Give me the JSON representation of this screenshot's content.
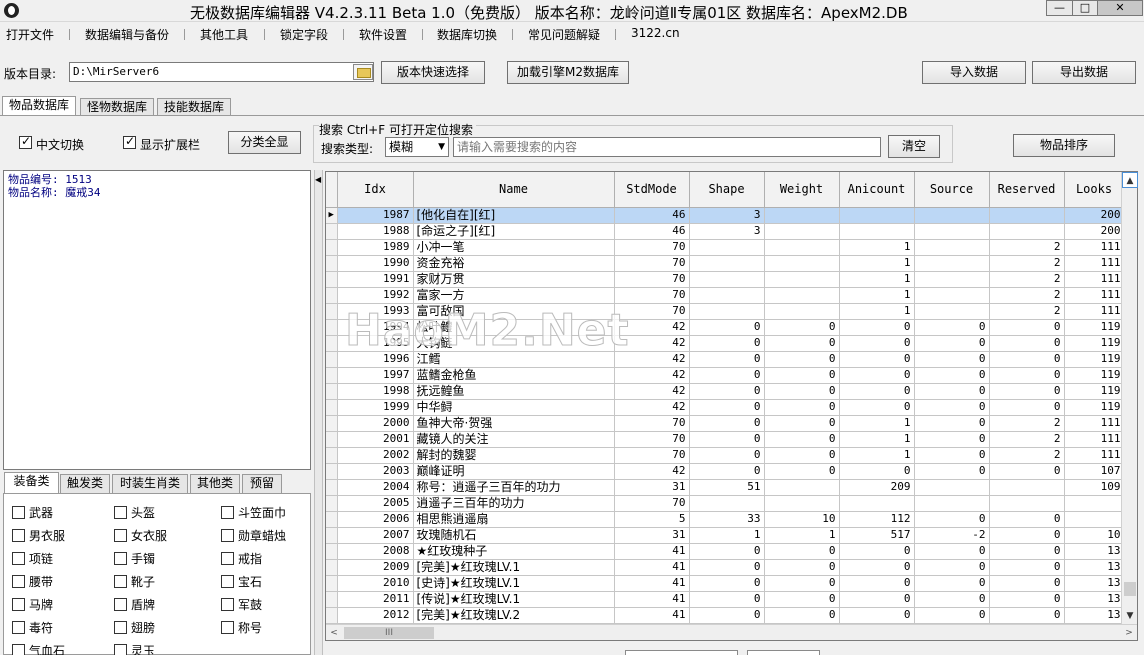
{
  "window": {
    "title": "无极数据库编辑器 V4.2.3.11    Beta 1.0（免费版）    版本名称：龙岭问道Ⅱ专属01区    数据库名：ApexM2.DB",
    "min": "—",
    "max": "□",
    "close": "✕"
  },
  "menu": [
    "打开文件",
    "数据编辑与备份",
    "其他工具",
    "锁定字段",
    "软件设置",
    "数据库切换",
    "常见问题解疑",
    "3122.cn"
  ],
  "toolbar": {
    "dir_label": "版本目录:",
    "dir_value": "D:\\MirServer6",
    "quick_select": "版本快速选择",
    "load_db": "加载引擎M2数据库",
    "import": "导入数据",
    "export": "导出数据"
  },
  "tabs": [
    "物品数据库",
    "怪物数据库",
    "技能数据库"
  ],
  "options": {
    "chinese_switch": "中文切换",
    "show_ext": "显示扩展栏",
    "show_all": "分类全显"
  },
  "search": {
    "title": "搜索  Ctrl+F 可打开定位搜索",
    "type_label": "搜索类型:",
    "type_value": "模糊",
    "placeholder": "请输入需要搜索的内容",
    "clear": "清空",
    "sort": "物品排序"
  },
  "info": {
    "line1": "物品编号: 1513",
    "line2": "物品名称: 魔戒34"
  },
  "category_tabs": [
    "装备类",
    "触发类",
    "时装生肖类",
    "其他类",
    "预留"
  ],
  "categories": [
    "武器",
    "头盔",
    "斗笠面巾",
    "男衣服",
    "女衣服",
    "勋章蜡烛",
    "项链",
    "手镯",
    "戒指",
    "腰带",
    "靴子",
    "宝石",
    "马牌",
    "盾牌",
    "军鼓",
    "毒符",
    "翅膀",
    "称号",
    "气血石",
    "灵玉"
  ],
  "grid": {
    "columns": [
      "Idx",
      "Name",
      "StdMode",
      "Shape",
      "Weight",
      "Anicount",
      "Source",
      "Reserved",
      "Looks"
    ],
    "rows": [
      [
        "1987",
        "[他化自在][红]",
        "46",
        "3",
        "",
        "",
        "",
        "",
        "200"
      ],
      [
        "1988",
        "[命运之子][红]",
        "46",
        "3",
        "",
        "",
        "",
        "",
        "200"
      ],
      [
        "1989",
        "小冲一笔",
        "70",
        "",
        "",
        "1",
        "",
        "2",
        "111"
      ],
      [
        "1990",
        "资金充裕",
        "70",
        "",
        "",
        "1",
        "",
        "2",
        "111"
      ],
      [
        "1991",
        "家财万贯",
        "70",
        "",
        "",
        "1",
        "",
        "2",
        "111"
      ],
      [
        "1992",
        "富家一方",
        "70",
        "",
        "",
        "1",
        "",
        "2",
        "111"
      ],
      [
        "1993",
        "富可敌国",
        "70",
        "",
        "",
        "1",
        "",
        "2",
        "111"
      ],
      [
        "1994",
        "松叶鳢",
        "42",
        "0",
        "0",
        "0",
        "0",
        "0",
        "119"
      ],
      [
        "1995",
        "大钩鲢",
        "42",
        "0",
        "0",
        "0",
        "0",
        "0",
        "119"
      ],
      [
        "1996",
        "江鳕",
        "42",
        "0",
        "0",
        "0",
        "0",
        "0",
        "119"
      ],
      [
        "1997",
        "蓝鳍金枪鱼",
        "42",
        "0",
        "0",
        "0",
        "0",
        "0",
        "119"
      ],
      [
        "1998",
        "抚远鳇鱼",
        "42",
        "0",
        "0",
        "0",
        "0",
        "0",
        "119"
      ],
      [
        "1999",
        "中华鲟",
        "42",
        "0",
        "0",
        "0",
        "0",
        "0",
        "119"
      ],
      [
        "2000",
        "鱼神大帝·贺强",
        "70",
        "0",
        "0",
        "1",
        "0",
        "2",
        "111"
      ],
      [
        "2001",
        "藏镜人的关注",
        "70",
        "0",
        "0",
        "1",
        "0",
        "2",
        "111"
      ],
      [
        "2002",
        "解封的魏婴",
        "70",
        "0",
        "0",
        "1",
        "0",
        "2",
        "111"
      ],
      [
        "2003",
        "巅峰证明",
        "42",
        "0",
        "0",
        "0",
        "0",
        "0",
        "107"
      ],
      [
        "2004",
        "称号：逍遥子三百年的功力",
        "31",
        "51",
        "",
        "209",
        "",
        "",
        "109"
      ],
      [
        "2005",
        "逍遥子三百年的功力",
        "70",
        "",
        "",
        "",
        "",
        "",
        ""
      ],
      [
        "2006",
        "相思熊逍遥扇",
        "5",
        "33",
        "10",
        "112",
        "0",
        "0",
        ""
      ],
      [
        "2007",
        "玫瑰随机石",
        "31",
        "1",
        "1",
        "517",
        "-2",
        "0",
        "10"
      ],
      [
        "2008",
        "★红玫瑰种子",
        "41",
        "0",
        "0",
        "0",
        "0",
        "0",
        "13"
      ],
      [
        "2009",
        "[完美]★红玫瑰LV.1",
        "41",
        "0",
        "0",
        "0",
        "0",
        "0",
        "13"
      ],
      [
        "2010",
        "[史诗]★红玫瑰LV.1",
        "41",
        "0",
        "0",
        "0",
        "0",
        "0",
        "13"
      ],
      [
        "2011",
        "[传说]★红玫瑰LV.1",
        "41",
        "0",
        "0",
        "0",
        "0",
        "0",
        "13"
      ],
      [
        "2012",
        "[完美]★红玫瑰LV.2",
        "41",
        "0",
        "0",
        "0",
        "0",
        "0",
        "13"
      ]
    ],
    "selected_row": 0
  },
  "scroll": {
    "up": "▲",
    "down": "▼",
    "left": "<",
    "right": ">",
    "thumb": "III"
  },
  "watermark": "HaoM2.Net",
  "colors": {
    "selection": "#bcd7f5",
    "info_text": "#000080"
  }
}
